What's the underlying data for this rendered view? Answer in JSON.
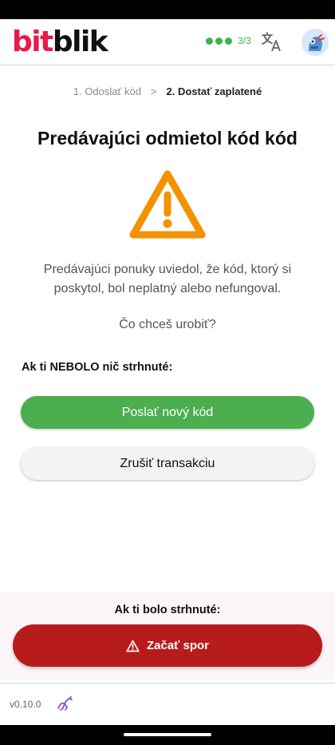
{
  "header": {
    "logo_part1": "bit",
    "logo_part2": "blik",
    "progress_text": "3/3",
    "translate_icon": "translate-icon",
    "avatar_icon": "robot-avatar-icon"
  },
  "stepper": {
    "step1": "1. Odoslať kód",
    "separator": ">",
    "step2": "2. Dostať zaplatené"
  },
  "main": {
    "title": "Predávajúci odmietol kód kód",
    "warning_icon": "warning-triangle-icon",
    "description": "Predávajúci ponuky uviedol, že kód, ktorý si poskytol, bol neplatný alebo nefungoval.",
    "question": "Čo chceš urobiť?",
    "not_charged_label": "Ak ti NEBOLO nič strhnuté:",
    "send_new_code_button": "Poslať nový kód",
    "cancel_button": "Zrušiť transakciu"
  },
  "dispute": {
    "charged_label": "Ak ti bolo strhnuté:",
    "button_label": "Začať spor"
  },
  "footer": {
    "version": "v0.10.0",
    "icon": "robosats-icon"
  },
  "colors": {
    "brand_red": "#e8194b",
    "success_green": "#4cae4f",
    "warning_orange": "#f39200",
    "danger_red": "#b81b1b"
  }
}
